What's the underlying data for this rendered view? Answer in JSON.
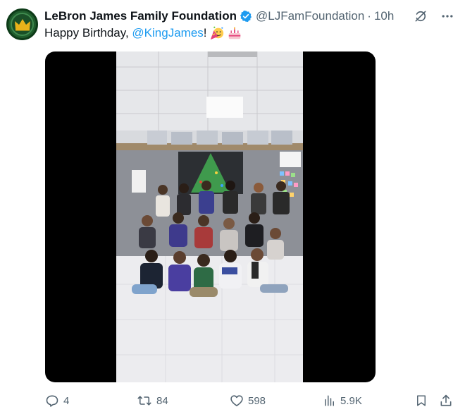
{
  "author": {
    "name": "LeBron James Family Foundation",
    "handle": "@LJFamFoundation",
    "separator": "·",
    "time": "10h",
    "verified": true
  },
  "post": {
    "text_prefix": "Happy Birthday, ",
    "mention": "@KingJames",
    "text_suffix": "!",
    "emojis": [
      "partying-face-emoji",
      "birthday-cake-emoji"
    ]
  },
  "media": {
    "type": "video",
    "icon": "video-thumbnail"
  },
  "actions": {
    "replies": "4",
    "reposts": "84",
    "likes": "598",
    "views": "5.9K"
  },
  "colors": {
    "accent": "#1d9bf0",
    "secondary_text": "#536471",
    "avatar_green": "#1f5c2c",
    "crown_gold": "#e8b21a"
  }
}
